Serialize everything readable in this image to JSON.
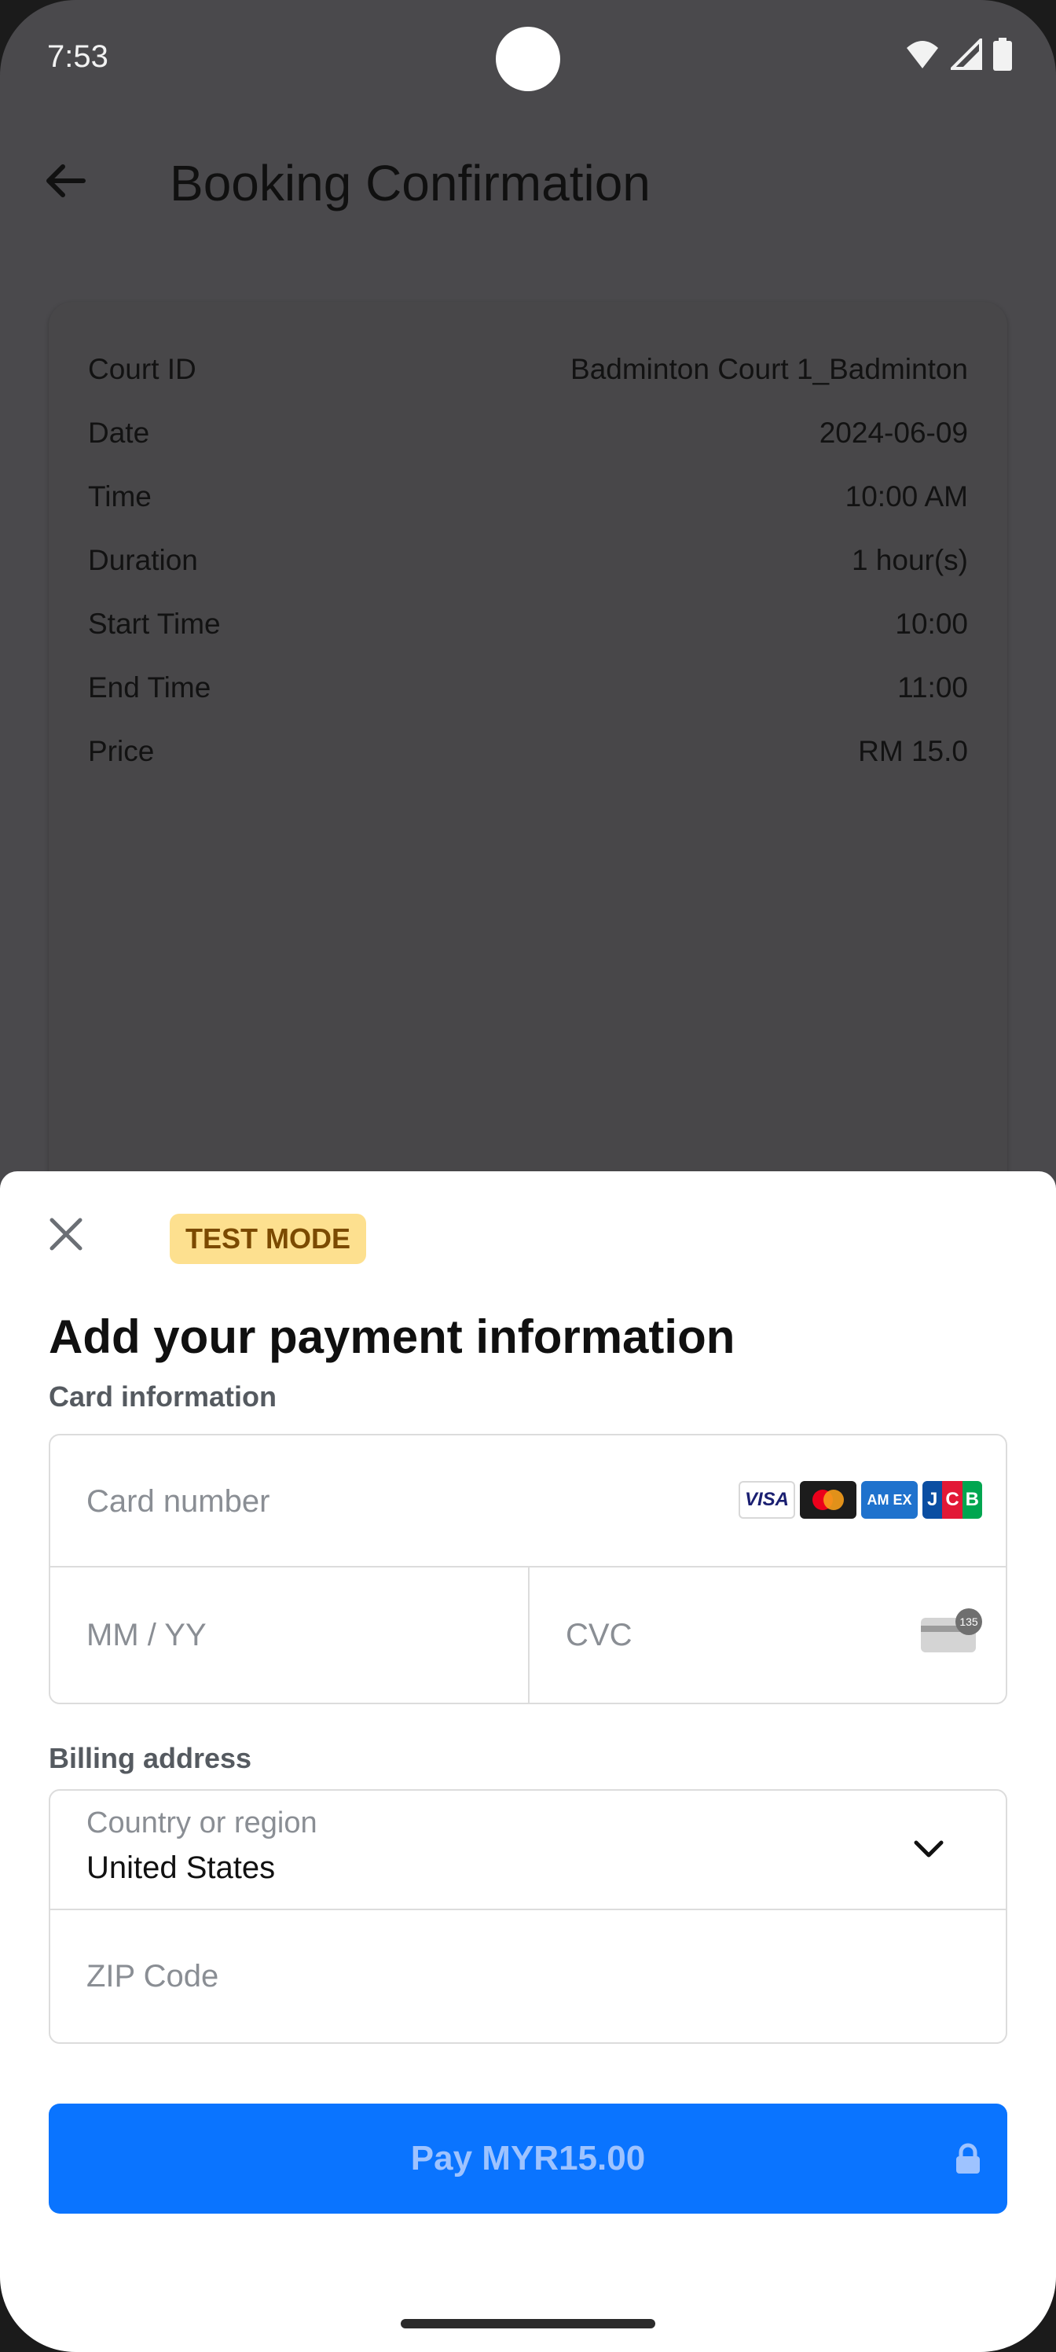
{
  "status_bar": {
    "time": "7:53"
  },
  "app_bar": {
    "title": "Booking Confirmation"
  },
  "booking": {
    "rows": [
      {
        "label": "Court ID",
        "value": "Badminton Court 1_Badminton"
      },
      {
        "label": "Date",
        "value": "2024-06-09"
      },
      {
        "label": "Time",
        "value": "10:00 AM"
      },
      {
        "label": "Duration",
        "value": "1 hour(s)"
      },
      {
        "label": "Start Time",
        "value": "10:00"
      },
      {
        "label": "End Time",
        "value": "11:00"
      },
      {
        "label": "Price",
        "value": "RM 15.0"
      }
    ]
  },
  "payment_sheet": {
    "badge": "TEST MODE",
    "title": "Add your payment information",
    "card_section_label": "Card information",
    "card_number_placeholder": "Card number",
    "expiry_placeholder": "MM / YY",
    "cvc_placeholder": "CVC",
    "cvc_badge": "135",
    "card_brands": [
      {
        "name": "VISA",
        "text": "VISA"
      },
      {
        "name": "Mastercard",
        "text": ""
      },
      {
        "name": "American Express",
        "text": "AM EX"
      },
      {
        "name": "JCB",
        "text": "JCB"
      }
    ],
    "billing_section_label": "Billing address",
    "country_label": "Country or region",
    "country_value": "United States",
    "zip_placeholder": "ZIP Code",
    "pay_button": "Pay MYR15.00"
  },
  "colors": {
    "scrim": "#4a494c",
    "pay_button": "#0a74ff",
    "test_badge_bg": "#fde08f",
    "test_badge_text": "#7b4a00"
  }
}
